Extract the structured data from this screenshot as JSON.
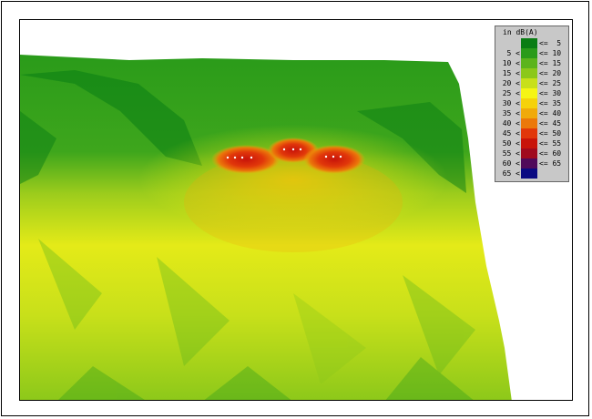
{
  "legend": {
    "title": "in dB(A)",
    "rows": [
      {
        "lower": "",
        "upper": "<=  5",
        "color": "#0a7d14"
      },
      {
        "lower": "5 <",
        "upper": "<= 10",
        "color": "#2a9b1a"
      },
      {
        "lower": "10 <",
        "upper": "<= 15",
        "color": "#5cb41c"
      },
      {
        "lower": "15 <",
        "upper": "<= 20",
        "color": "#8cc81a"
      },
      {
        "lower": "20 <",
        "upper": "<= 25",
        "color": "#c8e01a"
      },
      {
        "lower": "25 <",
        "upper": "<= 30",
        "color": "#f5f514"
      },
      {
        "lower": "30 <",
        "upper": "<= 35",
        "color": "#f5d20a"
      },
      {
        "lower": "35 <",
        "upper": "<= 40",
        "color": "#f0aa0a"
      },
      {
        "lower": "40 <",
        "upper": "<= 45",
        "color": "#eb780a"
      },
      {
        "lower": "45 <",
        "upper": "<= 50",
        "color": "#e1370a"
      },
      {
        "lower": "50 <",
        "upper": "<= 55",
        "color": "#c8140a"
      },
      {
        "lower": "55 <",
        "upper": "<= 60",
        "color": "#a00a1e"
      },
      {
        "lower": "60 <",
        "upper": "<= 65",
        "color": "#500a5a"
      },
      {
        "lower": "65 <",
        "upper": "",
        "color": "#0a0a82"
      }
    ]
  }
}
